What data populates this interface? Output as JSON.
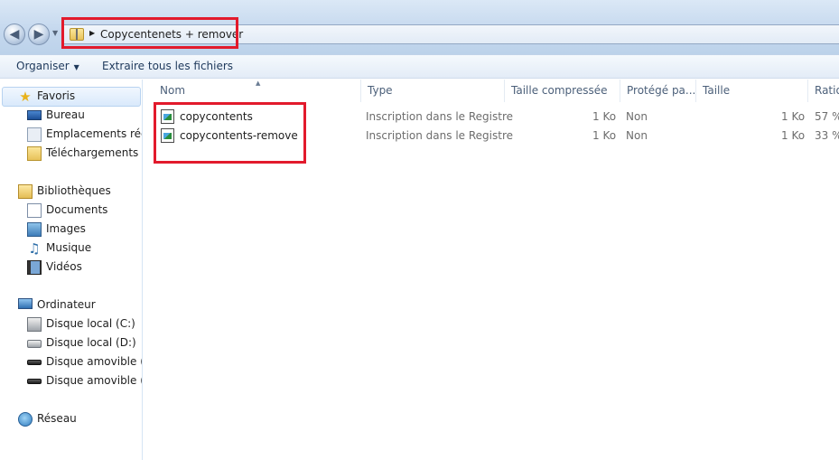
{
  "address": {
    "path_segment": "Copycentenets + remover"
  },
  "toolbar": {
    "organize_label": "Organiser",
    "extract_label": "Extraire tous les fichiers"
  },
  "nav": {
    "favorites": {
      "label": "Favoris",
      "items": [
        "Bureau",
        "Emplacements récents",
        "Téléchargements"
      ]
    },
    "libraries": {
      "label": "Bibliothèques",
      "items": [
        "Documents",
        "Images",
        "Musique",
        "Vidéos"
      ]
    },
    "computer": {
      "label": "Ordinateur",
      "items": [
        "Disque local (C:)",
        "Disque local (D:)",
        "Disque amovible (F:)",
        "Disque amovible (G:)"
      ]
    },
    "network": {
      "label": "Réseau"
    }
  },
  "columns": [
    "Nom",
    "Type",
    "Taille compressée",
    "Protégé pa...",
    "Taille",
    "Ratio"
  ],
  "files": [
    {
      "name": "copycontents",
      "type": "Inscription dans le Registre",
      "compressed": "1 Ko",
      "protected": "Non",
      "size": "1 Ko",
      "ratio": "57 %"
    },
    {
      "name": "copycontents-remove",
      "type": "Inscription dans le Registre",
      "compressed": "1 Ko",
      "protected": "Non",
      "size": "1 Ko",
      "ratio": "33 %"
    }
  ],
  "colors": {
    "highlight": "#e21a2c",
    "toolbar_text": "#1e395b"
  }
}
